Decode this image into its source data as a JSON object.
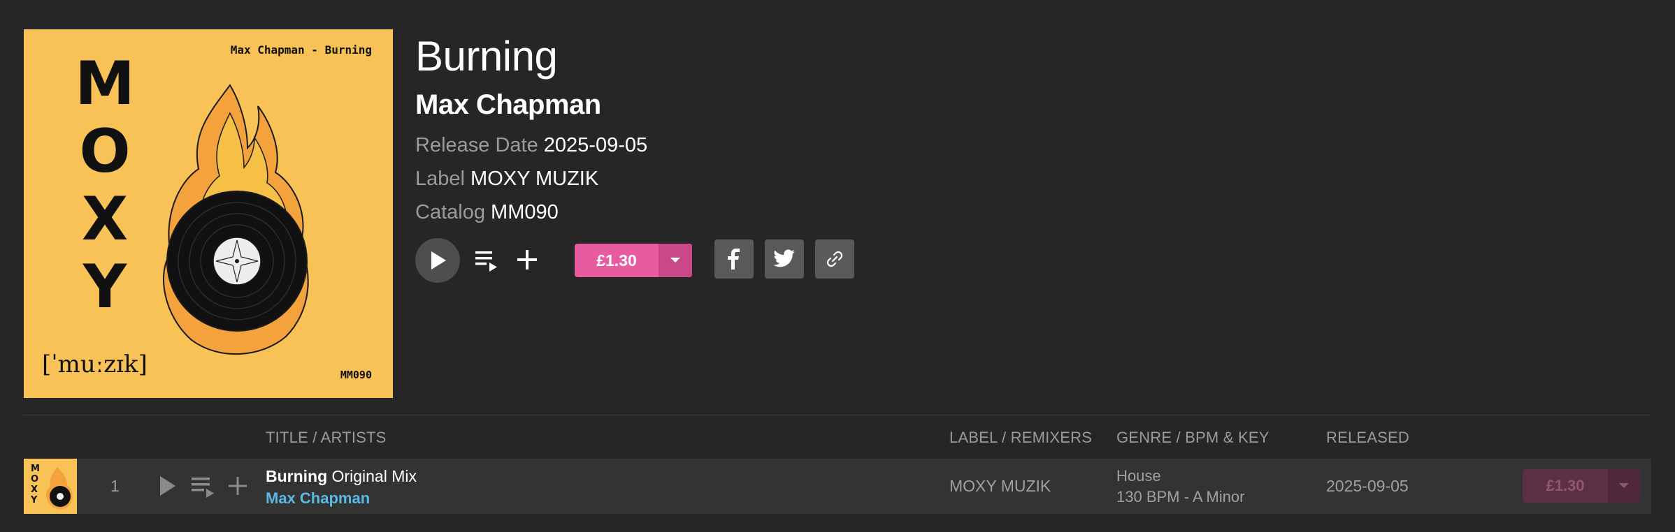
{
  "release": {
    "title": "Burning",
    "artist": "Max Chapman",
    "release_date_key": "Release Date",
    "release_date": "2025-09-05",
    "label_key": "Label",
    "label": "MOXY MUZIK",
    "catalog_key": "Catalog",
    "catalog": "MM090",
    "price": "£1.30"
  },
  "cover_art": {
    "letters": [
      "M",
      "O",
      "X",
      "Y"
    ],
    "top_text": "Max Chapman - Burning",
    "phonetic": "[ˈmuːzɪk]",
    "catalog_text": "MM090"
  },
  "table": {
    "headers": {
      "title_artists": "TITLE / ARTISTS",
      "label_remixers": "LABEL / REMIXERS",
      "genre_bpm_key": "GENRE / BPM & KEY",
      "released": "RELEASED"
    },
    "tracks": [
      {
        "number": "1",
        "title": "Burning",
        "mix": "Original Mix",
        "artist": "Max Chapman",
        "label": "MOXY MUZIK",
        "genre": "House",
        "bpm_key": "130 BPM - A Minor",
        "released": "2025-09-05",
        "price": "£1.30"
      }
    ]
  },
  "colors": {
    "background": "#262626",
    "accent_pink": "#e85b9e",
    "artist_link": "#5cb8e4",
    "cover_yellow": "#f8c256"
  },
  "icons": [
    "play-icon",
    "queue-icon",
    "plus-icon",
    "chevron-down-icon",
    "facebook-icon",
    "twitter-icon",
    "link-icon"
  ]
}
